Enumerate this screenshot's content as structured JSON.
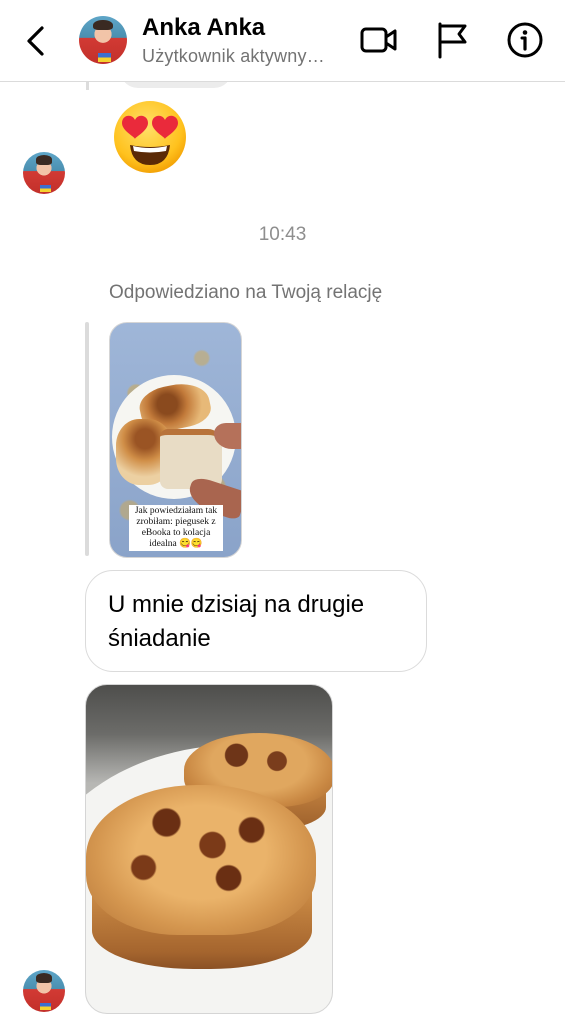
{
  "header": {
    "name": "Anka Anka",
    "status": "Użytkownik aktywny…"
  },
  "messages": {
    "time": "10:43",
    "replied_to_story": "Odpowiedziano na Twoją relację",
    "story_caption": "Jak powiedziałam tak zrobiłam: piegusek z eBooka to kolacja idealna 😋😋",
    "emoji": "😍",
    "text_line1": "U mnie dzisiaj na drugie",
    "text_line2": "śniadanie"
  },
  "icons": {
    "back": "chevron-left-icon",
    "video": "video-camera-icon",
    "flag": "flag-icon",
    "info": "info-icon"
  },
  "colors": {
    "border": "#dbdbdb",
    "secondary_text": "#737373"
  }
}
